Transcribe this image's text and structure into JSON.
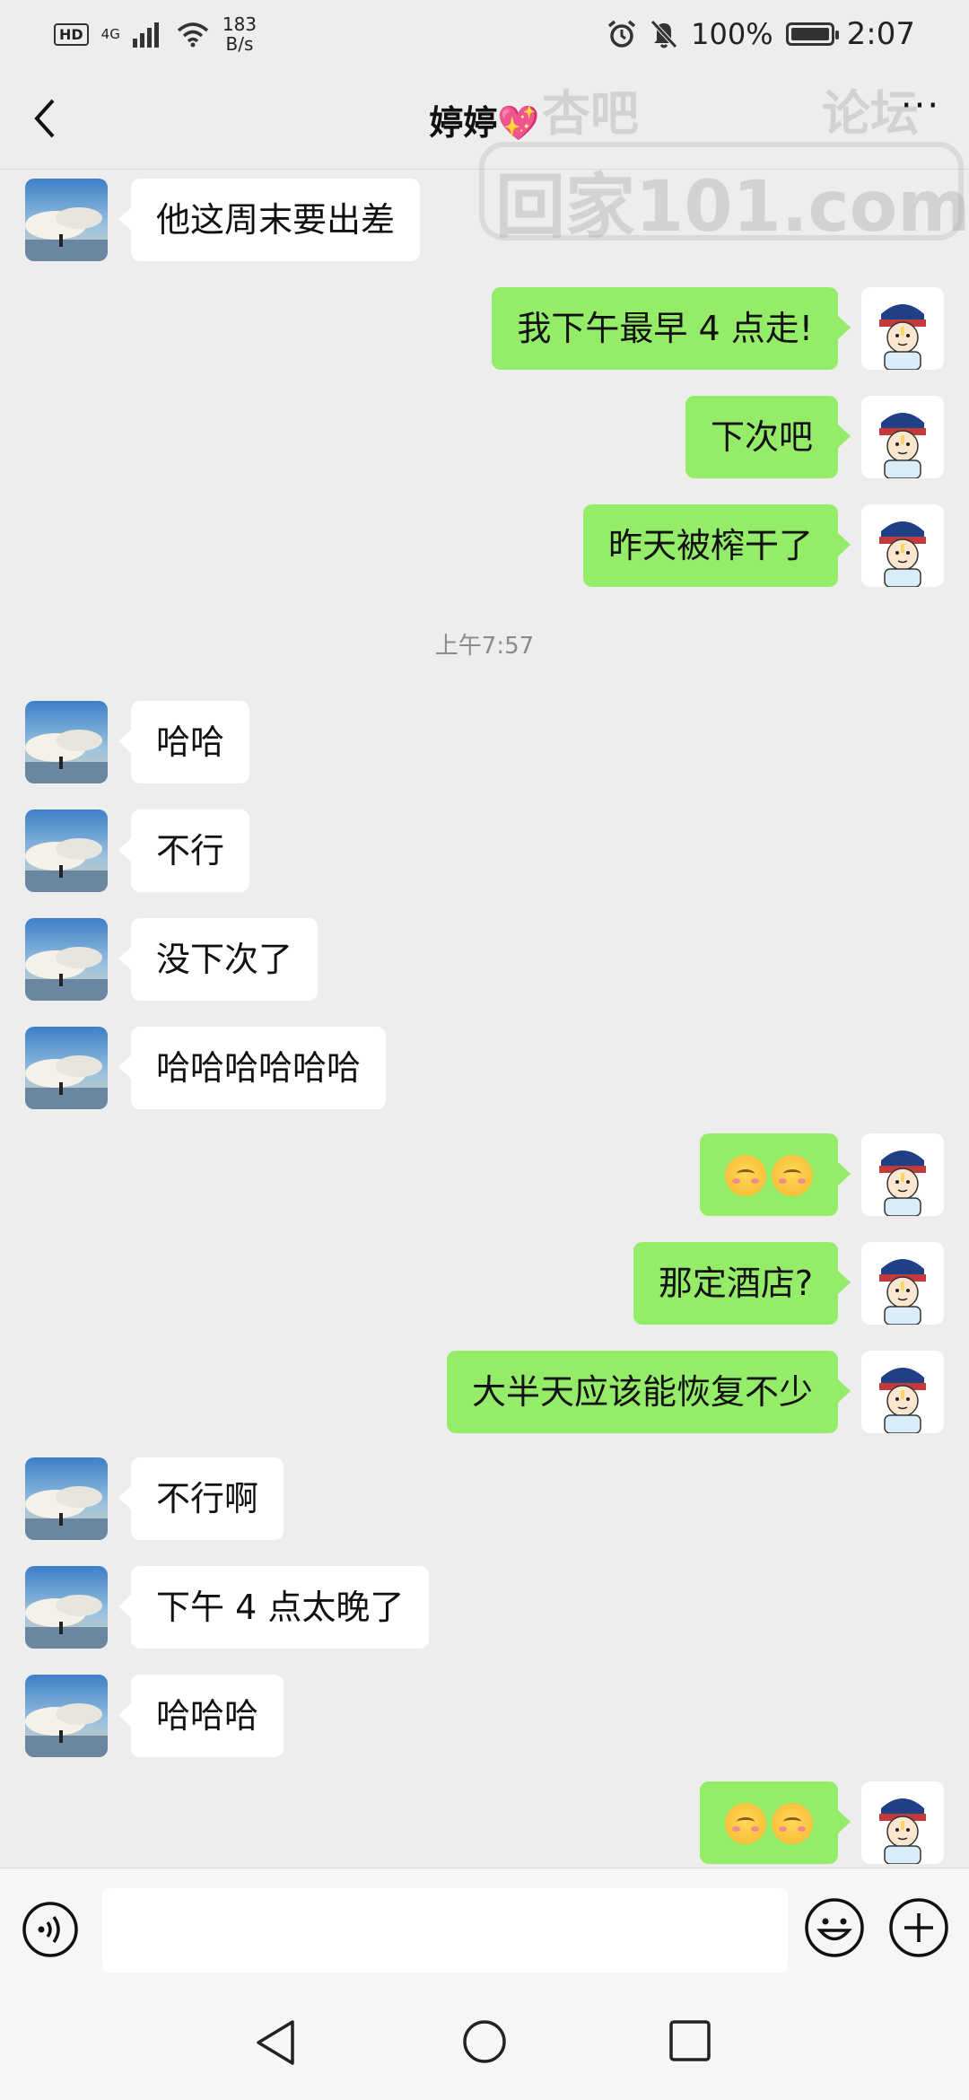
{
  "status_bar": {
    "hd": "HD",
    "network": "4G",
    "speed_value": "183",
    "speed_unit": "B/s",
    "battery": "100%",
    "battery_level": 1.0,
    "time": "2:07",
    "icons": [
      "signal-icon",
      "wifi-icon",
      "alarm-icon",
      "mute-icon",
      "battery-icon"
    ]
  },
  "header": {
    "title": "婷婷",
    "title_emoji": "💖",
    "back_icon": "chevron-left-icon",
    "more_label": "···"
  },
  "watermark": {
    "left_text": "杏吧",
    "right_text": "论坛",
    "site": "回家101.com"
  },
  "timestamp": "上午7:57",
  "messages": [
    {
      "side": "left",
      "text": "他这周末要出差"
    },
    {
      "side": "right",
      "text": "我下午最早 4 点走!"
    },
    {
      "side": "right",
      "text": "下次吧"
    },
    {
      "side": "right",
      "text": "昨天被榨干了"
    },
    {
      "side": "left",
      "text": "哈哈"
    },
    {
      "side": "left",
      "text": "不行"
    },
    {
      "side": "left",
      "text": "没下次了"
    },
    {
      "side": "left",
      "text": "哈哈哈哈哈哈"
    },
    {
      "side": "right",
      "text": "",
      "emoji": "blush-emoji x2"
    },
    {
      "side": "right",
      "text": "那定酒店?"
    },
    {
      "side": "right",
      "text": "大半天应该能恢复不少"
    },
    {
      "side": "left",
      "text": "不行啊"
    },
    {
      "side": "left",
      "text": "下午 4 点太晚了"
    },
    {
      "side": "left",
      "text": "哈哈哈"
    },
    {
      "side": "right",
      "text": "",
      "emoji": "blush-emoji x2"
    }
  ],
  "input_bar": {
    "placeholder": "",
    "icons": [
      "voice-icon",
      "emoji-icon",
      "plus-icon"
    ]
  },
  "nav_bar": {
    "icons": [
      "nav-back-icon",
      "nav-home-icon",
      "nav-recent-icon"
    ]
  },
  "colors": {
    "background": "#ededed",
    "sent_bubble": "#95ec69",
    "received_bubble": "#ffffff"
  }
}
